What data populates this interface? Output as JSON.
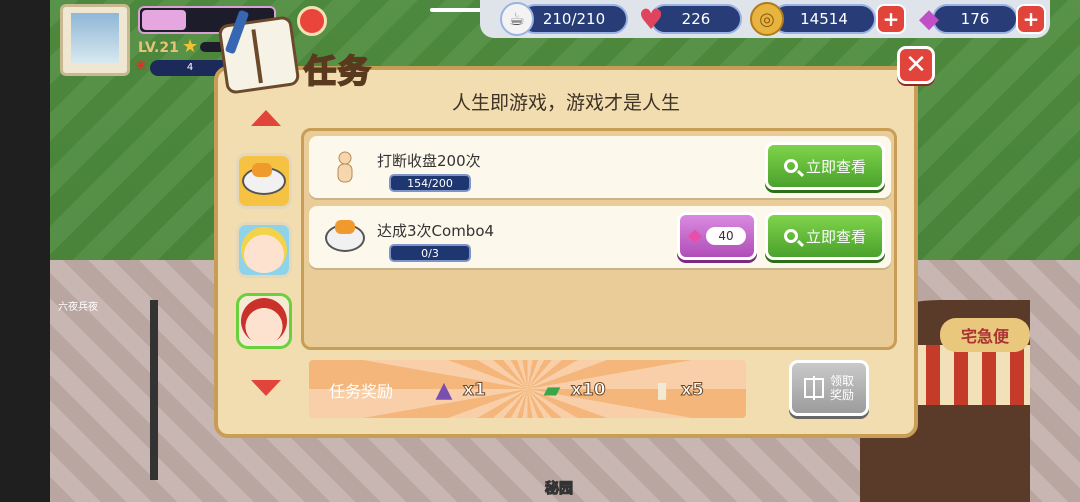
{
  "hud": {
    "level": "LV.21",
    "rose_count": "4",
    "stamina": "210/210",
    "hearts": "226",
    "coins": "14514",
    "gems": "176"
  },
  "scene": {
    "npc_name": "六夜兵夜",
    "shop_sign": "宅急便",
    "bottom_label": "秘园"
  },
  "dialog": {
    "title": "任务",
    "subtitle": "人生即游戏，游戏才是人生",
    "tasks": [
      {
        "title": "打断收盘200次",
        "progress": "154/200",
        "view_label": "立即查看"
      },
      {
        "title": "达成3次Combo4",
        "progress": "0/3",
        "gem_reward": "40",
        "view_label": "立即查看"
      }
    ],
    "reward_bar": {
      "label": "任务奖励",
      "items": [
        {
          "icon": "dress-icon",
          "count": "x1"
        },
        {
          "icon": "ticket-icon",
          "count": "x10"
        },
        {
          "icon": "bottle-icon",
          "count": "x5"
        }
      ]
    },
    "claim_label_line1": "领取",
    "claim_label_line2": "奖励"
  },
  "colors": {
    "accent_red": "#e0443b",
    "button_green": "#4ba22c",
    "panel_bg": "#f2ddb1",
    "gem_purple": "#b04db8"
  }
}
